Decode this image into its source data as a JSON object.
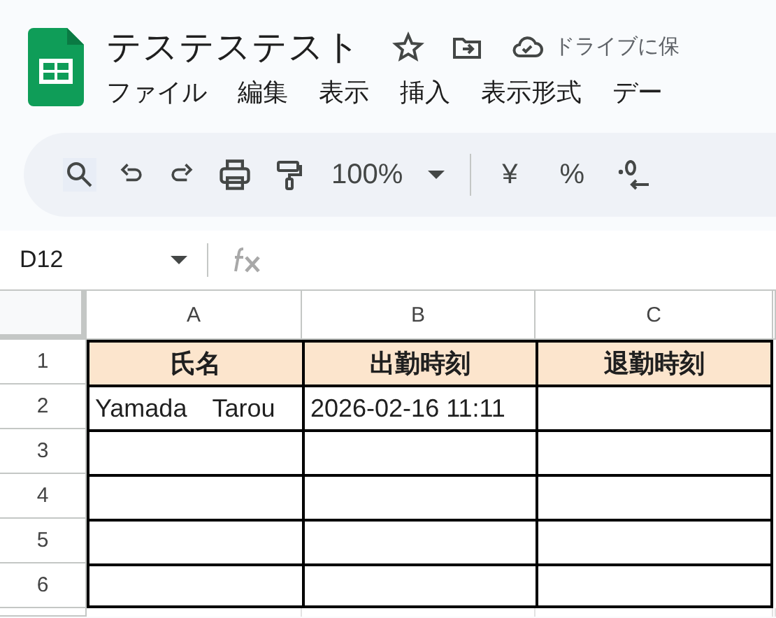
{
  "document": {
    "title": "テステステスト",
    "save_status": "ドライブに保"
  },
  "menu": [
    "ファイル",
    "編集",
    "表示",
    "挿入",
    "表示形式",
    "デー"
  ],
  "toolbar": {
    "zoom": "100%",
    "currency": "¥",
    "percent": "%"
  },
  "formula_bar": {
    "cell_ref": "D12"
  },
  "sheet": {
    "columns": [
      "A",
      "B",
      "C"
    ],
    "rows": [
      {
        "number": "1",
        "kind": "header",
        "cells": [
          "氏名",
          "出勤時刻",
          "退勤時刻"
        ]
      },
      {
        "number": "2",
        "kind": "data",
        "cells": [
          "Yamada　Tarou",
          "2026-02-16 11:11"
        ]
      },
      {
        "number": "3",
        "kind": "data"
      },
      {
        "number": "4",
        "kind": "data"
      },
      {
        "number": "5",
        "kind": "data"
      },
      {
        "number": "6",
        "kind": "data"
      }
    ]
  }
}
